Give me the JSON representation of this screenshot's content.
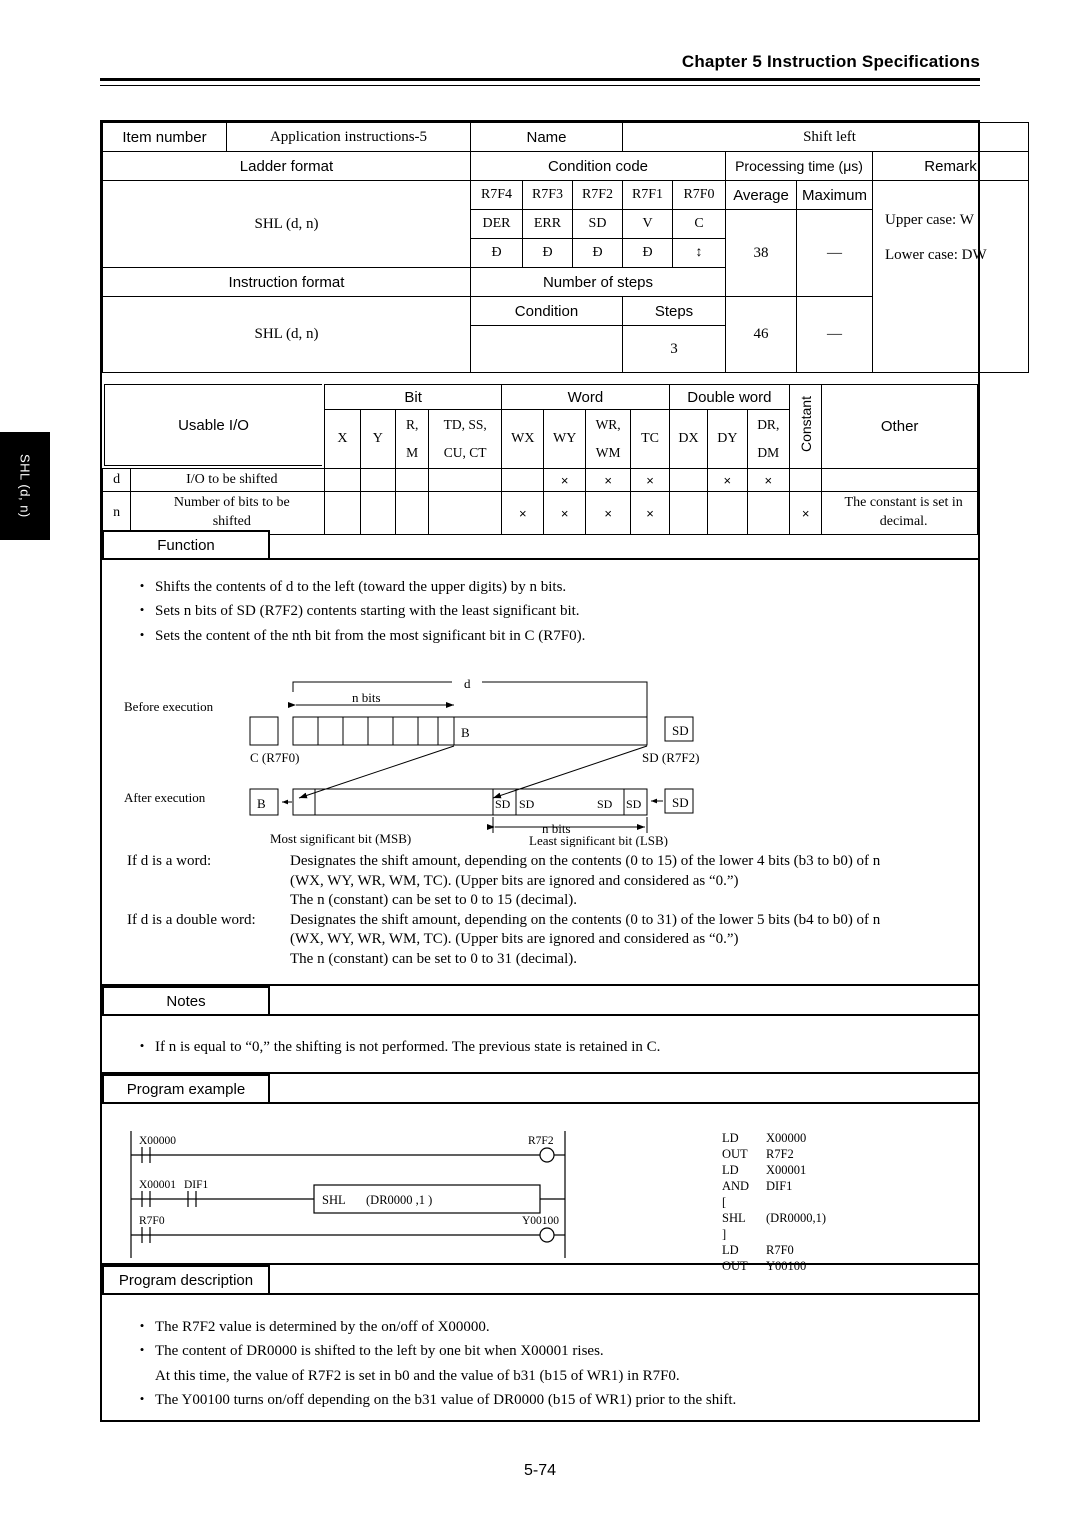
{
  "header": {
    "chapter": "Chapter 5  Instruction Specifications"
  },
  "side_tab": {
    "label": "SHL (d, n)"
  },
  "footer": {
    "page_number": "5-74"
  },
  "spec": {
    "item_number_label": "Item number",
    "item_number_value": "Application instructions-5",
    "name_label": "Name",
    "name_value": "Shift left",
    "ladder_format_label": "Ladder format",
    "condition_code_label": "Condition code",
    "processing_time_label": "Processing time (μs)",
    "remark_label": "Remark",
    "ladder_format_value": "SHL (d, n)",
    "instruction_format_label": "Instruction format",
    "instruction_format_value": "SHL (d, n)",
    "number_of_steps_label": "Number of steps",
    "condition_label": "Condition",
    "steps_label": "Steps",
    "condition_value": "",
    "steps_value": "3",
    "average_label": "Average",
    "maximum_label": "Maximum",
    "average_1": "38",
    "maximum_1": "—",
    "average_2": "46",
    "maximum_2": "—",
    "remark_line1": "Upper case: W",
    "remark_line2": "Lower case: DW",
    "cc_registers": [
      "R7F4",
      "R7F3",
      "R7F2",
      "R7F1",
      "R7F0"
    ],
    "cc_flags": [
      "DER",
      "ERR",
      "SD",
      "V",
      "C"
    ],
    "cc_effects": [
      "Đ",
      "Đ",
      "Đ",
      "Đ",
      "↕"
    ]
  },
  "usable_io": {
    "title": "Usable I/O",
    "group_bit": "Bit",
    "group_word": "Word",
    "group_dword": "Double word",
    "group_constant": "Constant",
    "group_other": "Other",
    "columns": [
      "X",
      "Y",
      "R,\nM",
      "TD, SS,\nCU, CT",
      "WX",
      "WY",
      "WR,\nWM",
      "TC",
      "DX",
      "DY",
      "DR,\nDM"
    ],
    "col_r_m": [
      "R,",
      "M"
    ],
    "col_td": [
      "TD, SS,",
      "CU, CT"
    ],
    "col_wr_wm": [
      "WR,",
      "WM"
    ],
    "col_dr_dm": [
      "DR,",
      "DM"
    ],
    "rows": [
      {
        "key": "d",
        "desc": "I/O to be shifted",
        "marks": [
          "",
          "",
          "",
          "",
          "",
          "×",
          "×",
          "×",
          "",
          "×",
          "×"
        ],
        "constant": "",
        "other": ""
      },
      {
        "key": "n",
        "desc": "Number of bits to be shifted",
        "desc_line1": "Number of bits to be",
        "desc_line2": "shifted",
        "marks": [
          "",
          "",
          "",
          "",
          "×",
          "×",
          "×",
          "×",
          "",
          "",
          ""
        ],
        "constant": "×",
        "other": "The constant is set in decimal.",
        "other_line1": "The constant is set in",
        "other_line2": "decimal."
      }
    ]
  },
  "function": {
    "tab_label": "Function",
    "bullets": [
      "Shifts the contents of d to the left (toward the upper digits) by n bits.",
      "Sets n bits of SD (R7F2) contents starting with the least significant bit.",
      "Sets the content of the nth bit from the most significant bit in C (R7F0)."
    ]
  },
  "diagram": {
    "before_label": "Before execution",
    "after_label": "After execution",
    "d_label": "d",
    "n_bits_top": "n bits",
    "n_bits_bottom": "n bits",
    "c_label": "C (R7F0)",
    "sd_label": "SD (R7F2)",
    "msb_label": "Most significant bit (MSB)",
    "lsb_label": "Least significant bit (LSB)",
    "b_cell": "B",
    "sd_cell": "SD"
  },
  "word_explanation": {
    "rows": [
      {
        "key": "If d is a word:",
        "lines": [
          "Designates the shift amount, depending on the contents (0 to 15) of the lower 4 bits (b3 to b0) of n",
          "(WX, WY, WR, WM, TC).  (Upper bits are ignored and considered as “0.”)",
          "The n (constant) can be set to 0 to 15 (decimal)."
        ]
      },
      {
        "key": "If d is a double word:",
        "lines": [
          "Designates the shift amount, depending on the contents (0 to 31) of the lower 5 bits (b4 to b0) of n",
          "(WX, WY, WR, WM, TC).  (Upper bits are ignored and considered as “0.”)",
          "The n (constant) can be set to 0 to 31 (decimal)."
        ]
      }
    ]
  },
  "notes": {
    "tab_label": "Notes",
    "bullets": [
      "If n is equal to “0,” the shifting is not performed.  The previous state is retained in C."
    ]
  },
  "program_example": {
    "tab_label": "Program example",
    "ladder": {
      "rung1_contact": "X00000",
      "rung1_coil": "R7F2",
      "rung2_contact1": "X00001",
      "rung2_contact2": "DIF1",
      "rung2_box": "SHL",
      "rung2_box_args": "(DR0000 ,1 )",
      "rung3_contact": "R7F0",
      "rung3_coil": "Y00100"
    },
    "mnemonics": [
      {
        "op": "LD",
        "operand": "X00000"
      },
      {
        "op": "OUT",
        "operand": "R7F2"
      },
      {
        "op": "LD",
        "operand": "X00001"
      },
      {
        "op": "AND",
        "operand": "DIF1"
      },
      {
        "op": "[",
        "operand": ""
      },
      {
        "op": "SHL",
        "operand": "(DR0000,1)"
      },
      {
        "op": "]",
        "operand": ""
      },
      {
        "op": "LD",
        "operand": "R7F0"
      },
      {
        "op": "OUT",
        "operand": "Y00100"
      }
    ]
  },
  "program_description": {
    "tab_label": "Program description",
    "bullets": [
      {
        "text": "The R7F2 value is determined by the on/off of X00000.",
        "cont": ""
      },
      {
        "text": "The content of DR0000 is shifted to the left by one bit when X00001 rises.",
        "cont": "At this time, the value of R7F2 is set in b0 and the value of b31 (b15 of WR1) in R7F0."
      },
      {
        "text": "The Y00100 turns on/off depending on the b31 value of DR0000 (b15 of WR1) prior to the shift.",
        "cont": ""
      }
    ]
  }
}
